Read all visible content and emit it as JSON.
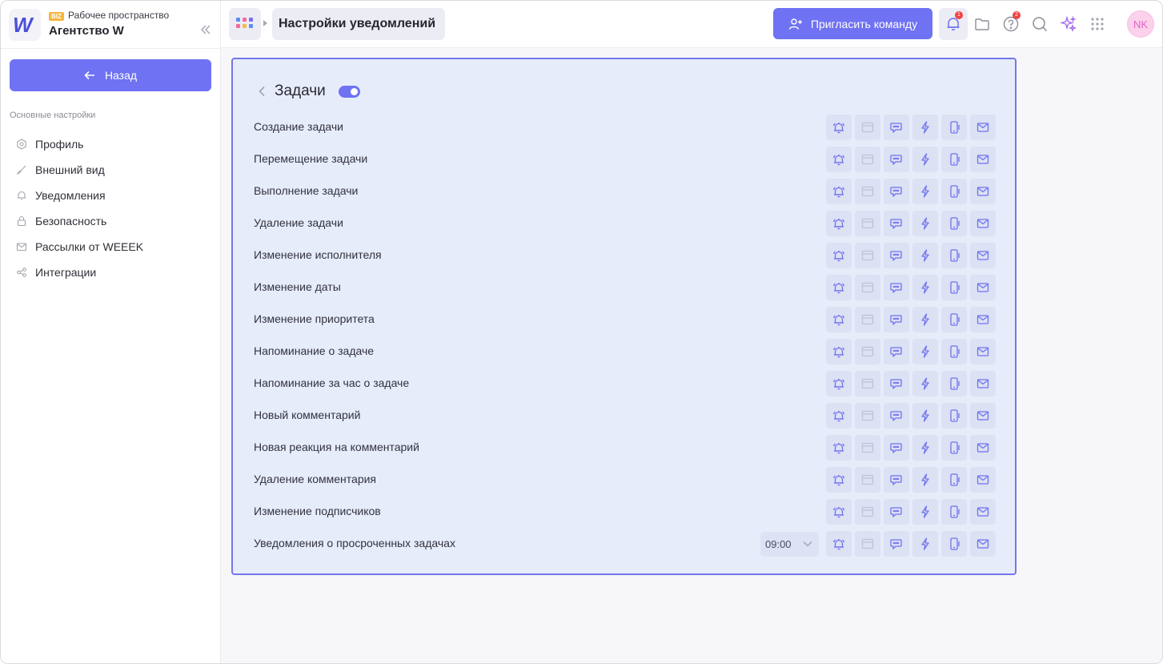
{
  "workspace": {
    "badge": "BIZ",
    "subtitle": "Рабочее пространство",
    "name": "Агентство W",
    "logo_letter": "W"
  },
  "sidebar": {
    "back_label": "Назад",
    "section_title": "Основные настройки",
    "items": [
      {
        "label": "Профиль",
        "icon": "profile-icon"
      },
      {
        "label": "Внешний вид",
        "icon": "brush-icon"
      },
      {
        "label": "Уведомления",
        "icon": "bell-icon"
      },
      {
        "label": "Безопасность",
        "icon": "lock-icon"
      },
      {
        "label": "Рассылки от WEEEK",
        "icon": "mail-icon"
      },
      {
        "label": "Интеграции",
        "icon": "integrations-icon"
      }
    ]
  },
  "header": {
    "page_title": "Настройки уведомлений",
    "invite_label": "Пригласить команду",
    "notifications_badge": "1",
    "help_badge": "2",
    "avatar_initials": "NK"
  },
  "panel": {
    "title": "Задачи",
    "enabled": true,
    "rows": [
      {
        "label": "Создание задачи"
      },
      {
        "label": "Перемещение задачи"
      },
      {
        "label": "Выполнение задачи"
      },
      {
        "label": "Удаление задачи"
      },
      {
        "label": "Изменение исполнителя"
      },
      {
        "label": "Изменение даты"
      },
      {
        "label": "Изменение приоритета"
      },
      {
        "label": "Напоминание о задаче"
      },
      {
        "label": "Напоминание за час о задаче"
      },
      {
        "label": "Новый комментарий"
      },
      {
        "label": "Новая реакция на комментарий"
      },
      {
        "label": "Удаление комментария"
      },
      {
        "label": "Изменение подписчиков"
      },
      {
        "label": "Уведомления о просроченных задачах",
        "time": "09:00"
      }
    ],
    "channels": [
      {
        "name": "bell-channel-icon",
        "enabled": true
      },
      {
        "name": "browser-channel-icon",
        "enabled": false
      },
      {
        "name": "chat-channel-icon",
        "enabled": true
      },
      {
        "name": "lightning-channel-icon",
        "enabled": true
      },
      {
        "name": "mobile-channel-icon",
        "enabled": true
      },
      {
        "name": "email-channel-icon",
        "enabled": true
      }
    ]
  },
  "colors": {
    "accent": "#6f72f2",
    "panel_bg": "#e7ecfb",
    "panel_border": "#7377ea"
  }
}
